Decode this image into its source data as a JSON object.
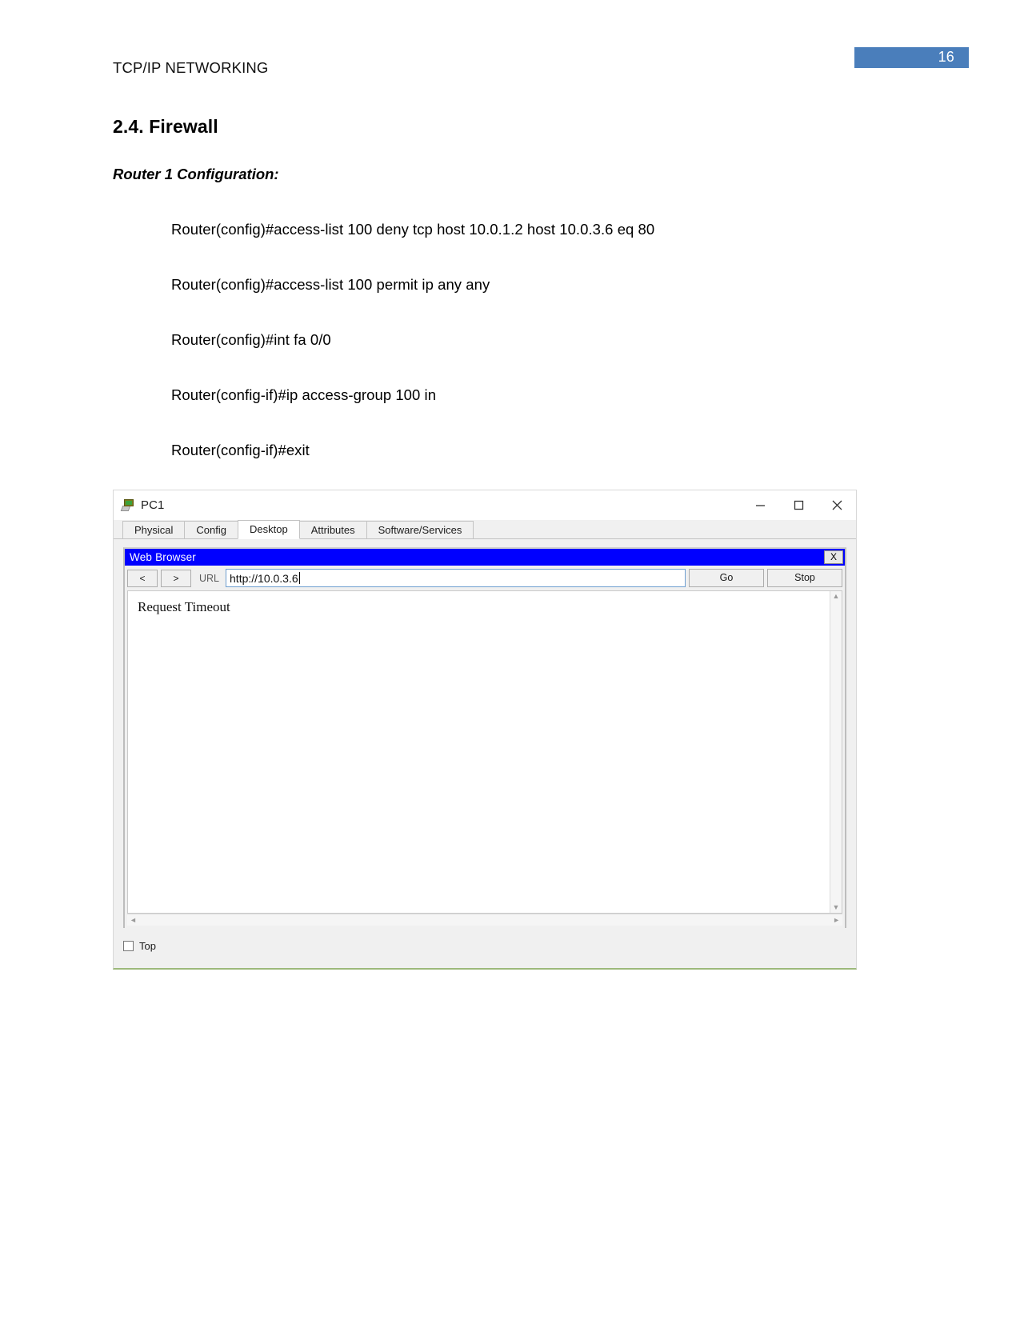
{
  "document": {
    "running_head": "TCP/IP NETWORKING",
    "page_number": "16",
    "badge_color": "#4a7ebb",
    "section_heading": "2.4. Firewall",
    "subheading": "Router 1 Configuration:",
    "commands": [
      "Router(config)#access-list 100 deny tcp host 10.0.1.2 host 10.0.3.6 eq 80",
      "Router(config)#access-list 100 permit ip any any",
      "Router(config)#int fa 0/0",
      "Router(config-if)#ip access-group 100 in",
      "Router(config-if)#exit"
    ]
  },
  "pc_window": {
    "title": "PC1",
    "icon": "pc-device-icon",
    "window_controls": {
      "minimize": "minimize-icon",
      "maximize": "maximize-icon",
      "close": "close-icon"
    },
    "tabs": [
      {
        "label": "Physical",
        "active": false
      },
      {
        "label": "Config",
        "active": false
      },
      {
        "label": "Desktop",
        "active": true
      },
      {
        "label": "Attributes",
        "active": false
      },
      {
        "label": "Software/Services",
        "active": false
      }
    ],
    "browser": {
      "title": "Web Browser",
      "title_bg": "#0000ff",
      "close_label": "X",
      "back_label": "<",
      "forward_label": ">",
      "url_label": "URL",
      "url_value": "http://10.0.3.6",
      "go_label": "Go",
      "stop_label": "Stop",
      "page_text": "Request Timeout",
      "scroll_up": "▲",
      "scroll_down": "▼",
      "scroll_left": "◄",
      "scroll_right": "►"
    },
    "statusbar": {
      "top_checkbox_label": "Top",
      "top_checkbox_checked": false
    }
  }
}
